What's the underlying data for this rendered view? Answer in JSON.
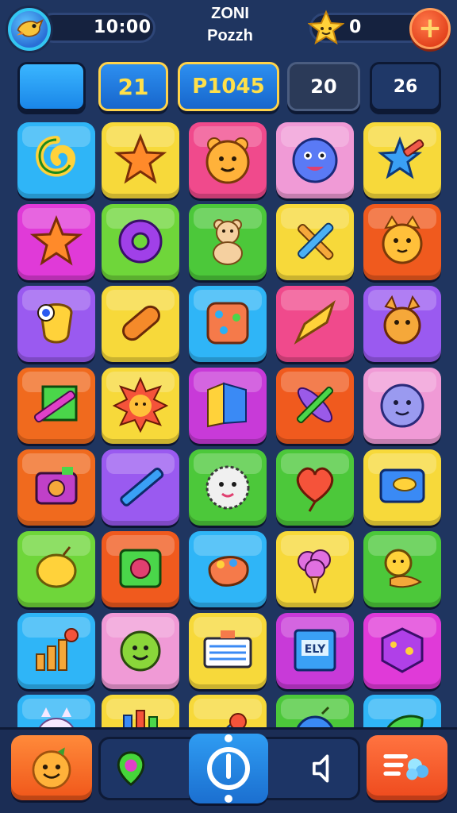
{
  "header": {
    "timer": "10:00",
    "title_line1": "ZONI",
    "title_line2": "Pozzh",
    "coins": "0",
    "add_label": "+"
  },
  "stats": [
    "",
    "21",
    "P1045",
    "20",
    "26"
  ],
  "grid": {
    "rows": [
      [
        {
          "bg": "#2fb5f7",
          "icon": "swirl-icon"
        },
        {
          "bg": "#f7d93a",
          "icon": "star-icon"
        },
        {
          "bg": "#f04a8c",
          "icon": "bear-face-icon"
        },
        {
          "bg": "#f09ad6",
          "icon": "blue-monster-icon"
        },
        {
          "bg": "#f7d93a",
          "icon": "star-pencil-icon"
        }
      ],
      [
        {
          "bg": "#e03ad8",
          "icon": "star-icon"
        },
        {
          "bg": "#6fd63a",
          "icon": "donut-icon"
        },
        {
          "bg": "#4cc83a",
          "icon": "teddy-bear-icon"
        },
        {
          "bg": "#f7d93a",
          "icon": "crossed-pencils-icon"
        },
        {
          "bg": "#f05a1e",
          "icon": "cat-face-icon"
        }
      ],
      [
        {
          "bg": "#9a5af0",
          "icon": "cyclops-icon"
        },
        {
          "bg": "#f7d93a",
          "icon": "pill-icon"
        },
        {
          "bg": "#2fb5f7",
          "icon": "dice-face-icon"
        },
        {
          "bg": "#f04a8c",
          "icon": "pencil-tip-icon"
        },
        {
          "bg": "#9a5af0",
          "icon": "fox-face-icon"
        }
      ],
      [
        {
          "bg": "#f06a1e",
          "icon": "square-pencil-icon"
        },
        {
          "bg": "#f7d93a",
          "icon": "sun-face-icon"
        },
        {
          "bg": "#c83ad8",
          "icon": "folded-map-icon"
        },
        {
          "bg": "#f05a1e",
          "icon": "crossed-leaf-icon"
        },
        {
          "bg": "#f09ad6",
          "icon": "cloud-face-icon"
        }
      ],
      [
        {
          "bg": "#f06a1e",
          "icon": "camera-icon"
        },
        {
          "bg": "#9a5af0",
          "icon": "pencil-icon"
        },
        {
          "bg": "#4cc83a",
          "icon": "fluffy-monster-icon"
        },
        {
          "bg": "#4cc83a",
          "icon": "heart-balloon-icon"
        },
        {
          "bg": "#f7d93a",
          "icon": "photo-bird-icon"
        }
      ],
      [
        {
          "bg": "#6fd63a",
          "icon": "lemon-icon"
        },
        {
          "bg": "#f05a1e",
          "icon": "frame-button-icon"
        },
        {
          "bg": "#2fb5f7",
          "icon": "paint-palette-icon"
        },
        {
          "bg": "#f7d93a",
          "icon": "cotton-candy-icon"
        },
        {
          "bg": "#4cc83a",
          "icon": "snake-bear-icon"
        }
      ],
      [
        {
          "bg": "#2fb5f7",
          "icon": "chart-gear-icon"
        },
        {
          "bg": "#f09ad6",
          "icon": "smiley-blob-icon"
        },
        {
          "bg": "#f7d93a",
          "icon": "keyboard-icon"
        },
        {
          "bg": "#c83ad8",
          "icon": "book-icon"
        },
        {
          "bg": "#e03ad8",
          "icon": "cube-icon"
        }
      ],
      [
        {
          "bg": "#2fb5f7",
          "icon": "ghost-cat-icon"
        },
        {
          "bg": "#f7d93a",
          "icon": "crayons-icon"
        },
        {
          "bg": "#f7d93a",
          "icon": "shuttlecock-icon"
        },
        {
          "bg": "#4cc83a",
          "icon": "blue-ball-icon"
        },
        {
          "bg": "#2fb5f7",
          "icon": "leaf-face-icon"
        }
      ]
    ]
  },
  "bottom": {
    "left_icon": "smiley-icon",
    "center_left_icon": "map-pin-icon",
    "center_icon": "power-icon",
    "center_right_icon": "sound-icon",
    "right_icon": "menu-bubbles-icon"
  }
}
